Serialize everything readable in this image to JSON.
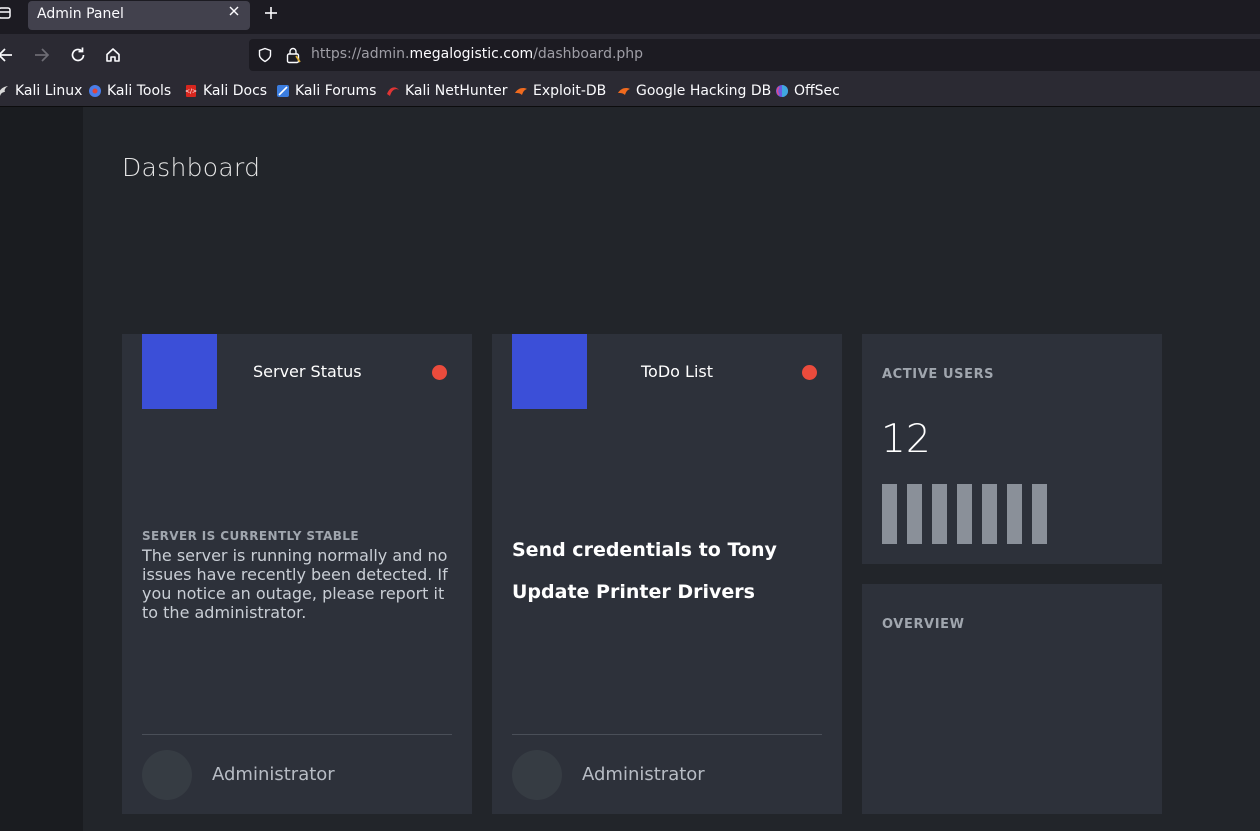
{
  "browser": {
    "tab": {
      "title": "Admin Panel"
    },
    "url": {
      "prefix": "https://admin.",
      "domain": "megalogistic.com",
      "path": "/dashboard.php"
    },
    "bookmarks": [
      {
        "label": "Kali Linux",
        "icon": "kali-dragon-icon",
        "color": "#d8d8d8"
      },
      {
        "label": "Kali Tools",
        "icon": "kali-tools-icon",
        "color": "#4a7de8"
      },
      {
        "label": "Kali Docs",
        "icon": "kali-docs-icon",
        "color": "#d7261e"
      },
      {
        "label": "Kali Forums",
        "icon": "kali-forums-icon",
        "color": "#3b7de0"
      },
      {
        "label": "Kali NetHunter",
        "icon": "kali-nethunter-icon",
        "color": "#e03434"
      },
      {
        "label": "Exploit-DB",
        "icon": "exploit-db-icon",
        "color": "#f06a1e"
      },
      {
        "label": "Google Hacking DB",
        "icon": "ghdb-icon",
        "color": "#f06a1e"
      },
      {
        "label": "OffSec",
        "icon": "offsec-icon",
        "color": "#6a5be0"
      }
    ]
  },
  "page": {
    "title": "Dashboard",
    "server_card": {
      "name": "Server Status",
      "status_heading": "SERVER IS CURRENTLY STABLE",
      "status_body": "The server is running normally and no issues have recently been detected. If you notice an outage, please report it to the administrator.",
      "footer_name": "Administrator"
    },
    "todo_card": {
      "name": "ToDo List",
      "items": [
        "Send credentials to Tony",
        "Update Printer Drivers"
      ],
      "footer_name": "Administrator"
    },
    "active_users": {
      "label": "ACTIVE USERS",
      "value": "12",
      "bars": [
        1,
        1,
        1,
        1,
        1,
        1,
        1
      ]
    },
    "overview": {
      "label": "OVERVIEW"
    },
    "colors": {
      "accent": "#3b4fd8",
      "status_dot": "#ea4b3c",
      "card_bg": "#2d313a",
      "page_bg": "#22252a"
    }
  }
}
